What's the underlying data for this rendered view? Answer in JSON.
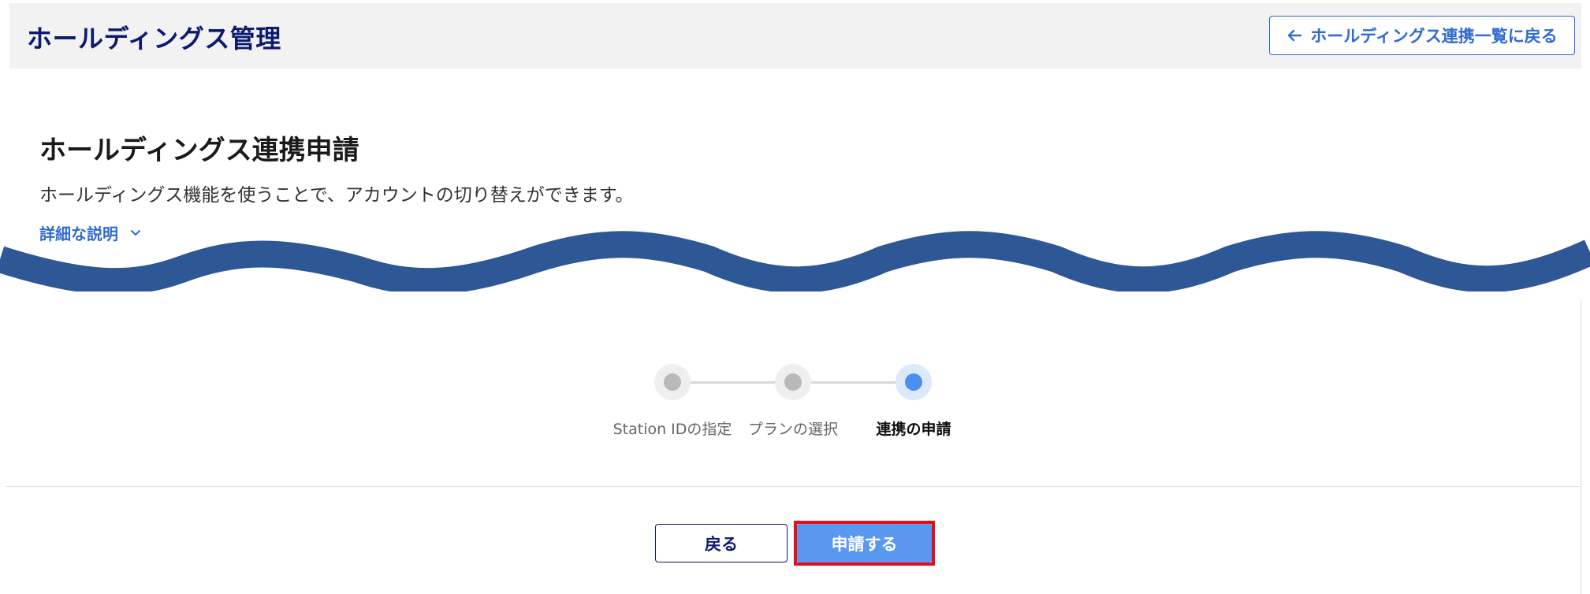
{
  "header": {
    "title": "ホールディングス管理",
    "back_to_list_label": "ホールディングス連携一覧に戻る"
  },
  "section": {
    "title": "ホールディングス連携申請",
    "description": "ホールディングス機能を使うことで、アカウントの切り替えができます。",
    "detail_link_label": "詳細な説明"
  },
  "stepper": {
    "steps": [
      {
        "label": "Station IDの指定",
        "state": "done"
      },
      {
        "label": "プランの選択",
        "state": "done"
      },
      {
        "label": "連携の申請",
        "state": "current"
      }
    ]
  },
  "footer": {
    "back_label": "戻る",
    "apply_label": "申請する"
  },
  "colors": {
    "header_title": "#0d1a6e",
    "link_blue": "#2f6bd1",
    "wave": "#2e5796",
    "primary_button": "#5a98ef",
    "highlight_frame": "#e0101a",
    "active_step": "#4d8ff0"
  }
}
